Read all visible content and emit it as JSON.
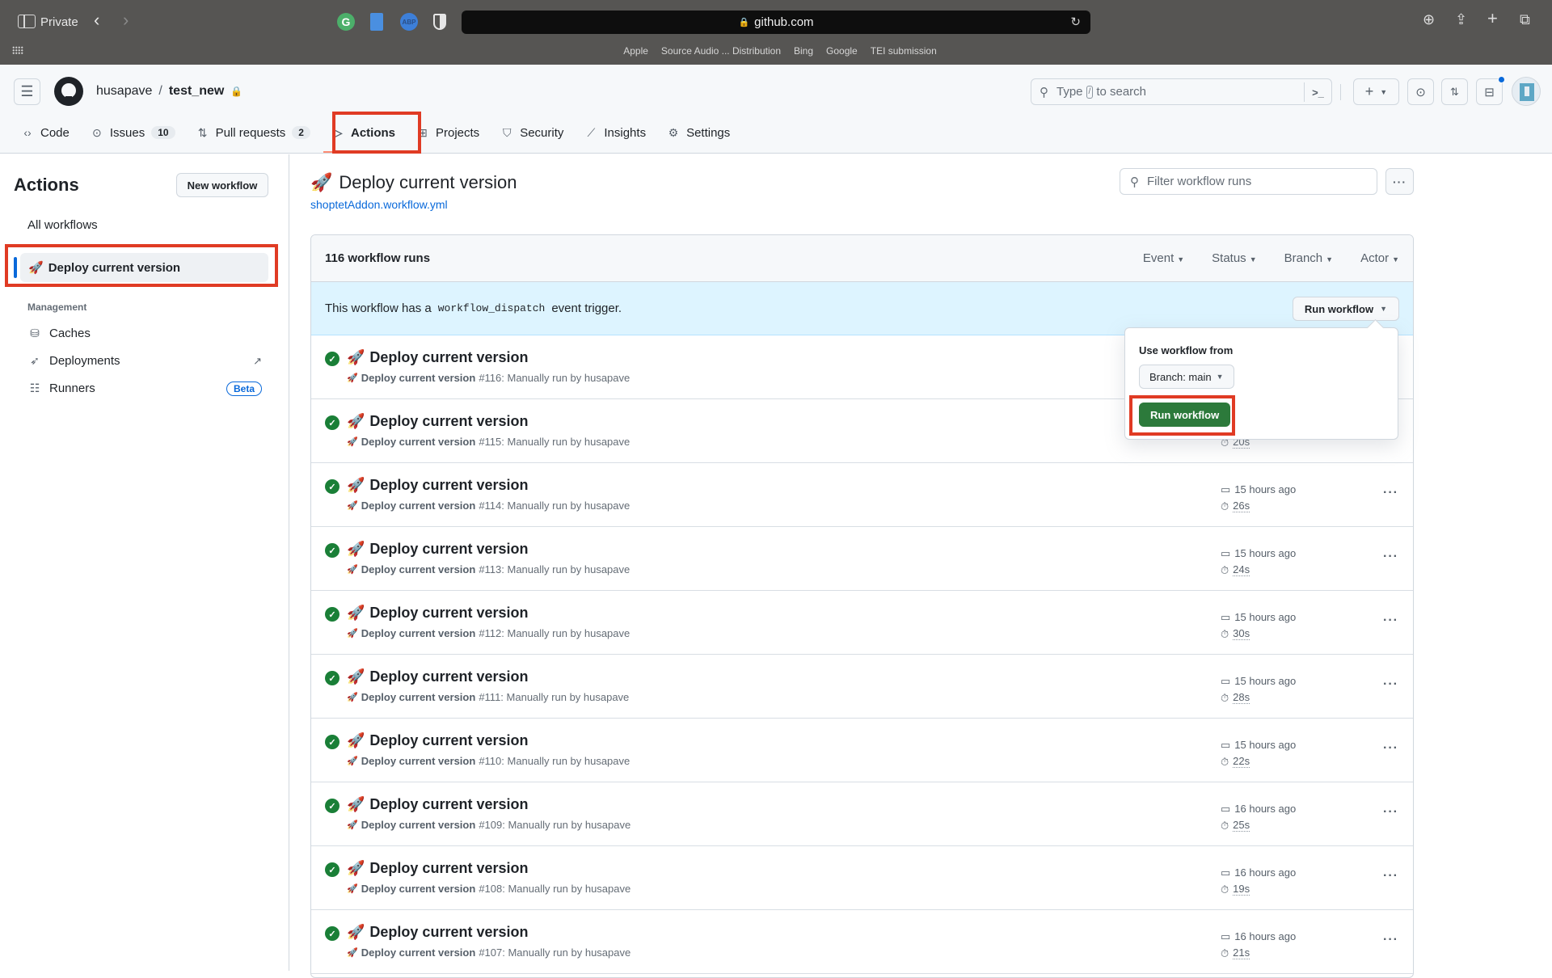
{
  "browser": {
    "private_label": "Private",
    "url": "github.com",
    "bookmarks": [
      "Apple",
      "Source Audio ... Distribution",
      "Bing",
      "Google",
      "TEI submission"
    ]
  },
  "header": {
    "owner": "husapave",
    "separator": "/",
    "repo": "test_new",
    "search_prefix": "Type",
    "search_key": "/",
    "search_suffix": "to search"
  },
  "tabs": [
    {
      "label": "Code",
      "icon": "code-icon"
    },
    {
      "label": "Issues",
      "icon": "issue-icon",
      "count": "10"
    },
    {
      "label": "Pull requests",
      "icon": "pull-request-icon",
      "count": "2"
    },
    {
      "label": "Actions",
      "icon": "play-icon",
      "active": true
    },
    {
      "label": "Projects",
      "icon": "table-icon"
    },
    {
      "label": "Security",
      "icon": "shield-icon"
    },
    {
      "label": "Insights",
      "icon": "graph-icon"
    },
    {
      "label": "Settings",
      "icon": "gear-icon"
    }
  ],
  "sidebar": {
    "title": "Actions",
    "new_workflow": "New workflow",
    "all_workflows": "All workflows",
    "active_workflow": "Deploy current version",
    "section": "Management",
    "items": [
      {
        "label": "Caches",
        "icon": "database-icon"
      },
      {
        "label": "Deployments",
        "icon": "rocket-icon",
        "trail": "↗"
      },
      {
        "label": "Runners",
        "icon": "server-icon",
        "badge": "Beta"
      }
    ]
  },
  "main": {
    "title": "Deploy current version",
    "file": "shoptetAddon.workflow.yml",
    "filter_placeholder": "Filter workflow runs",
    "runs_count": "116 workflow runs",
    "filters": [
      "Event",
      "Status",
      "Branch",
      "Actor"
    ],
    "dispatch_pre": "This workflow has a",
    "dispatch_code": "workflow_dispatch",
    "dispatch_post": "event trigger.",
    "run_workflow": "Run workflow"
  },
  "popup": {
    "label": "Use workflow from",
    "branch": "Branch: main",
    "run_button": "Run workflow"
  },
  "runs": [
    {
      "title": "Deploy current version",
      "name": "Deploy current version",
      "detail": "#116: Manually run by husapave",
      "time": "",
      "duration": ""
    },
    {
      "title": "Deploy current version",
      "name": "Deploy current version",
      "detail": "#115: Manually run by husapave",
      "time": "",
      "duration": "20s"
    },
    {
      "title": "Deploy current version",
      "name": "Deploy current version",
      "detail": "#114: Manually run by husapave",
      "time": "15 hours ago",
      "duration": "26s"
    },
    {
      "title": "Deploy current version",
      "name": "Deploy current version",
      "detail": "#113: Manually run by husapave",
      "time": "15 hours ago",
      "duration": "24s"
    },
    {
      "title": "Deploy current version",
      "name": "Deploy current version",
      "detail": "#112: Manually run by husapave",
      "time": "15 hours ago",
      "duration": "30s"
    },
    {
      "title": "Deploy current version",
      "name": "Deploy current version",
      "detail": "#111: Manually run by husapave",
      "time": "15 hours ago",
      "duration": "28s"
    },
    {
      "title": "Deploy current version",
      "name": "Deploy current version",
      "detail": "#110: Manually run by husapave",
      "time": "15 hours ago",
      "duration": "22s"
    },
    {
      "title": "Deploy current version",
      "name": "Deploy current version",
      "detail": "#109: Manually run by husapave",
      "time": "16 hours ago",
      "duration": "25s"
    },
    {
      "title": "Deploy current version",
      "name": "Deploy current version",
      "detail": "#108: Manually run by husapave",
      "time": "16 hours ago",
      "duration": "19s"
    },
    {
      "title": "Deploy current version",
      "name": "Deploy current version",
      "detail": "#107: Manually run by husapave",
      "time": "16 hours ago",
      "duration": "21s"
    }
  ],
  "colors": {
    "success": "#1a7f37",
    "highlight": "#e03b24",
    "link": "#0969da",
    "primary_button": "#2c7a3b"
  }
}
